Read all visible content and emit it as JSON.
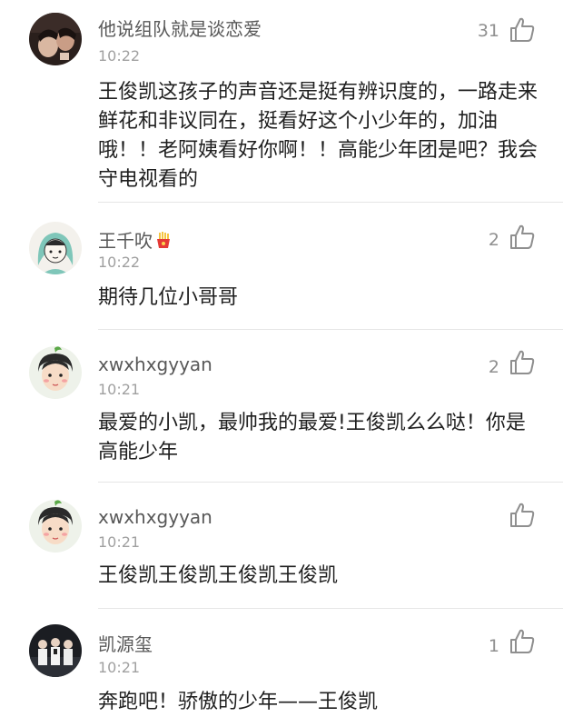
{
  "comments": [
    {
      "username": "他说组队就是谈恋爱",
      "time": "10:22",
      "likes": "31",
      "text": "王俊凯这孩子的声音还是挺有辨识度的，一路走来鲜花和非议同在，挺看好这个小少年的，加油哦！！老阿姨看好你啊！！高能少年团是吧？我会守电视看的"
    },
    {
      "username": "王千吹",
      "username_emoji": "fries-emoji",
      "time": "10:22",
      "likes": "2",
      "text": "期待几位小哥哥"
    },
    {
      "username": "xwxhxgyyan",
      "time": "10:21",
      "likes": "2",
      "text": "最爱的小凯，最帅我的最爱!王俊凯么么哒！你是高能少年"
    },
    {
      "username": "xwxhxgyyan",
      "time": "10:21",
      "likes": "",
      "text": "王俊凯王俊凯王俊凯王俊凯"
    },
    {
      "username": "凯源玺",
      "time": "10:21",
      "likes": "1",
      "text": "奔跑吧！骄傲的少年——王俊凯"
    }
  ],
  "icons": {
    "like": "thumbs-up-icon"
  },
  "colors": {
    "username": "#585858",
    "timestamp": "#a0a0a0",
    "body": "#1f1f1f",
    "like": "#8f8f8f",
    "divider": "#e6e6e6"
  }
}
